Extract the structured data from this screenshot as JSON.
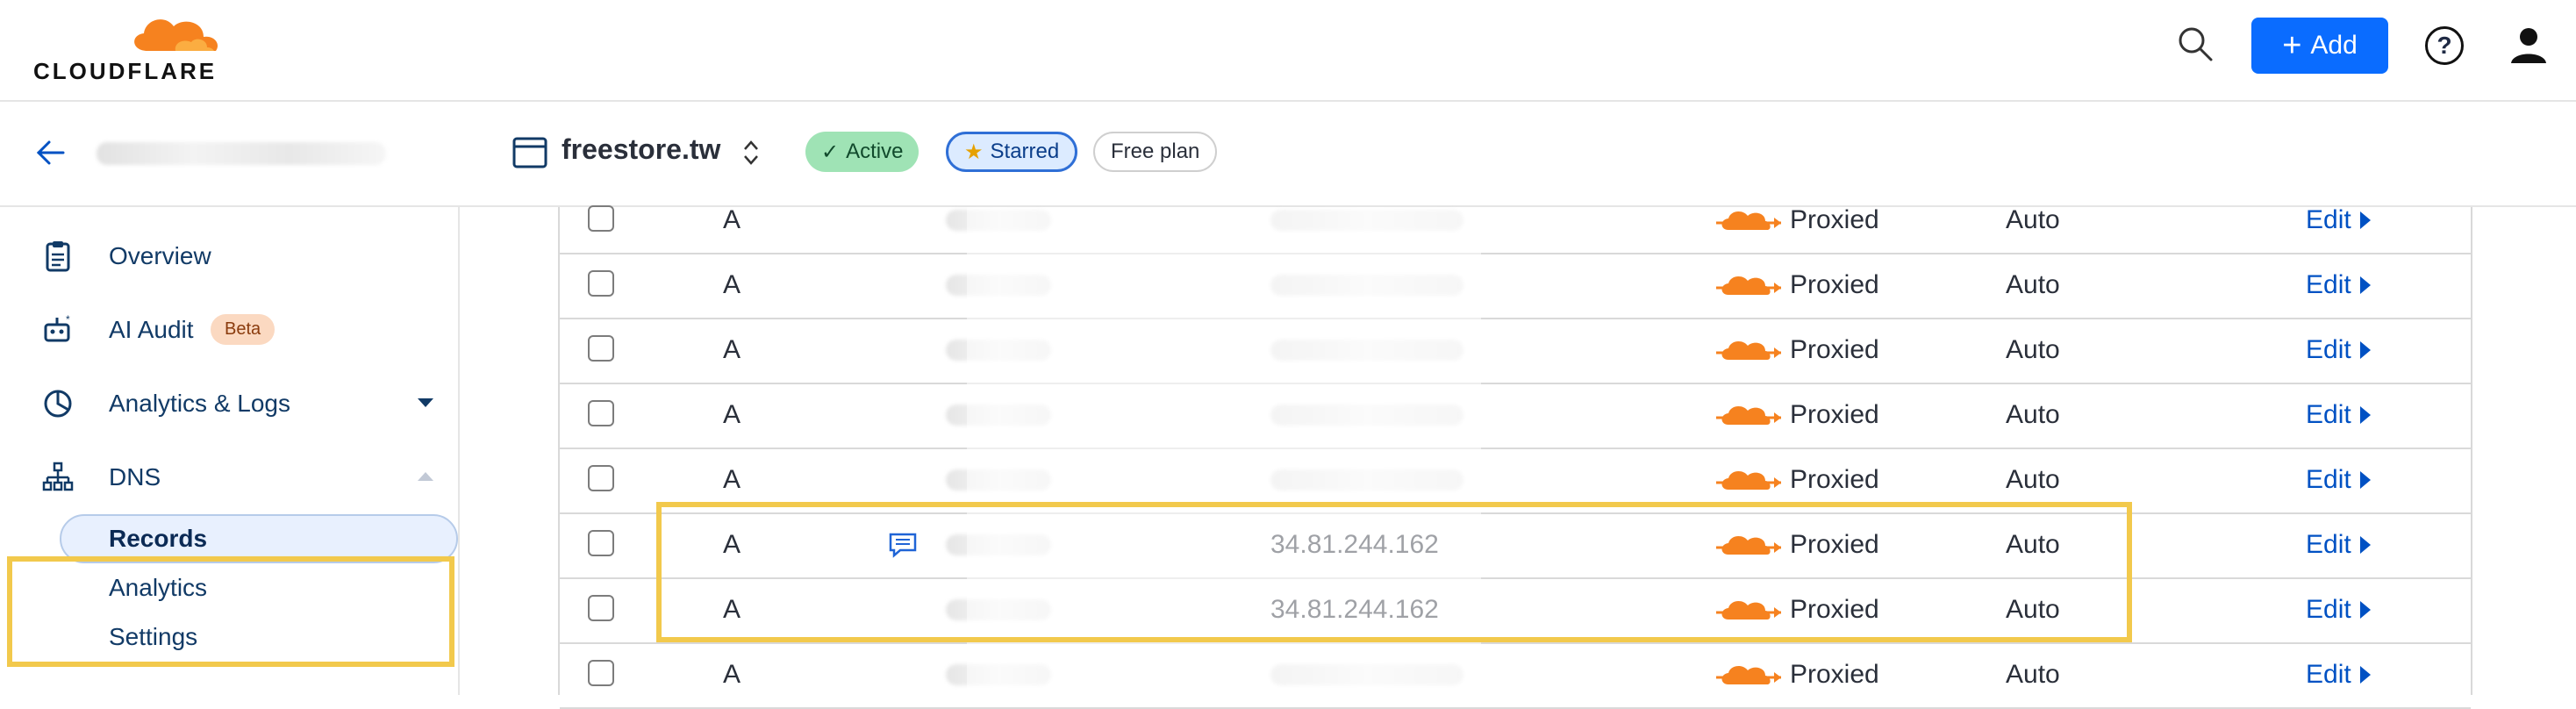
{
  "brand": {
    "name": "CLOUDFLARE",
    "logo_color": "#F6821F"
  },
  "topbar": {
    "add_label": "Add",
    "icons": [
      "search-icon",
      "help-icon",
      "user-icon"
    ]
  },
  "sidebar": {
    "account_name_blurred": "",
    "items": [
      {
        "label": "Overview",
        "icon": "clipboard-icon"
      },
      {
        "label": "AI Audit",
        "icon": "robot-icon",
        "badge": "Beta"
      },
      {
        "label": "Analytics & Logs",
        "icon": "pie-chart-icon",
        "expandable": true
      },
      {
        "label": "DNS",
        "icon": "network-icon",
        "expanded": true
      }
    ],
    "dns_children": [
      "Records",
      "Analytics",
      "Settings"
    ],
    "selected_child": "Records"
  },
  "zone": {
    "name": "freestore.tw",
    "status": "Active",
    "starred": "Starred",
    "plan": "Free plan"
  },
  "table": {
    "rows": [
      {
        "type": "A",
        "content": "",
        "proxy": "Proxied",
        "ttl": "Auto",
        "action": "Edit",
        "comment": false
      },
      {
        "type": "A",
        "content": "",
        "proxy": "Proxied",
        "ttl": "Auto",
        "action": "Edit",
        "comment": false
      },
      {
        "type": "A",
        "content": "",
        "proxy": "Proxied",
        "ttl": "Auto",
        "action": "Edit",
        "comment": false
      },
      {
        "type": "A",
        "content": "",
        "proxy": "Proxied",
        "ttl": "Auto",
        "action": "Edit",
        "comment": false
      },
      {
        "type": "A",
        "content": "",
        "proxy": "Proxied",
        "ttl": "Auto",
        "action": "Edit",
        "comment": false
      },
      {
        "type": "A",
        "content": "34.81.244.162",
        "proxy": "Proxied",
        "ttl": "Auto",
        "action": "Edit",
        "comment": true
      },
      {
        "type": "A",
        "content": "34.81.244.162",
        "proxy": "Proxied",
        "ttl": "Auto",
        "action": "Edit",
        "comment": false
      },
      {
        "type": "A",
        "content": "",
        "proxy": "Proxied",
        "ttl": "Auto",
        "action": "Edit",
        "comment": false
      }
    ]
  },
  "colors": {
    "accent": "#0051C3",
    "button": "#0A6CFF",
    "highlight": "#F2C94C",
    "active_pill": "#9FE3B5"
  }
}
